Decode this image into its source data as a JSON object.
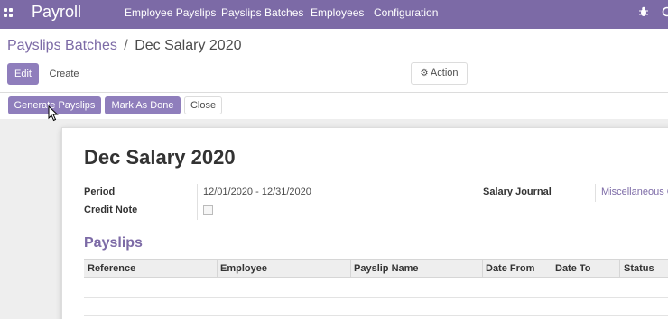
{
  "navbar": {
    "brand": "Payroll",
    "menu": [
      "Employee Payslips",
      "Payslips Batches",
      "Employees",
      "Configuration"
    ],
    "colors": {
      "primary": "#7c6aa6",
      "button": "#8f7ebc"
    }
  },
  "breadcrumb": {
    "parent": "Payslips Batches",
    "separator": "/",
    "current": "Dec Salary 2020"
  },
  "controls": {
    "edit": "Edit",
    "create": "Create",
    "action": "Action"
  },
  "statusbar": {
    "generate": "Generate Payslips",
    "mark_done": "Mark As Done",
    "close": "Close"
  },
  "form": {
    "title": "Dec Salary 2020",
    "period_label": "Period",
    "period_value": "12/01/2020 - 12/31/2020",
    "credit_note_label": "Credit Note",
    "salary_journal_label": "Salary Journal",
    "salary_journal_value": "Miscellaneous O",
    "payslips_title": "Payslips",
    "columns": [
      "Reference",
      "Employee",
      "Payslip Name",
      "Date From",
      "Date To",
      "Status"
    ]
  }
}
